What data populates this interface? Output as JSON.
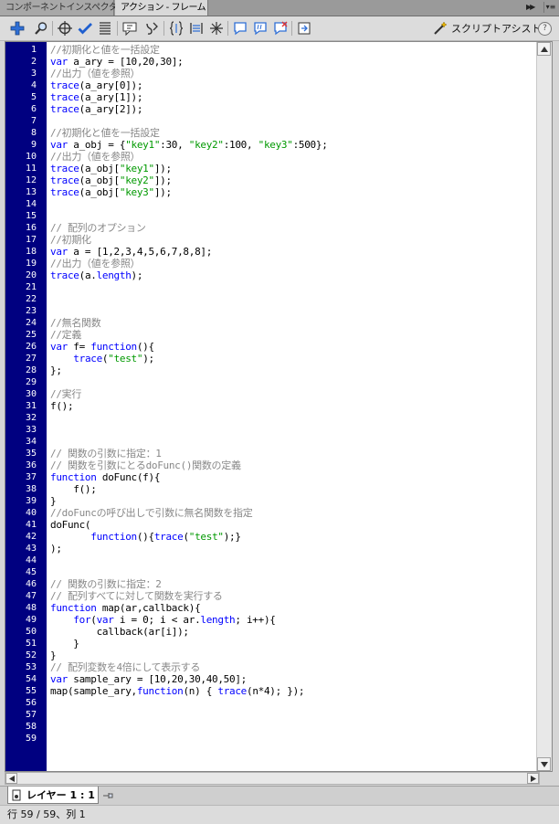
{
  "tabs": [
    {
      "label": "コンポーネントインスペクタ",
      "active": false
    },
    {
      "label": "アクション - フレーム",
      "active": true
    }
  ],
  "toolbar": {
    "icons": [
      "add-script-item-icon",
      "find-icon",
      "insert-target-path-icon",
      "check-syntax-icon",
      "auto-format-icon",
      "show-code-hint-icon",
      "debug-options-icon",
      "collapse-between-braces-icon",
      "collapse-selection-icon",
      "expand-all-icon",
      "apply-block-comment-icon",
      "apply-line-comment-icon",
      "remove-comment-icon",
      "show-hide-toolbox-icon"
    ],
    "script_assist_label": "スクリプトアシスト",
    "help_label": "?"
  },
  "colors": {
    "keyword": "#0000ff",
    "comment": "#888888",
    "string": "#009900",
    "gutter": "#000080"
  },
  "code": [
    [
      [
        "c",
        "//初期化と値を一括設定"
      ]
    ],
    [
      [
        "k",
        "var"
      ],
      [
        "t",
        " a_ary = [10,20,30];"
      ]
    ],
    [
      [
        "c",
        "//出力（値を参照）"
      ]
    ],
    [
      [
        "k",
        "trace"
      ],
      [
        "t",
        "(a_ary[0]);"
      ]
    ],
    [
      [
        "k",
        "trace"
      ],
      [
        "t",
        "(a_ary[1]);"
      ]
    ],
    [
      [
        "k",
        "trace"
      ],
      [
        "t",
        "(a_ary[2]);"
      ]
    ],
    [],
    [
      [
        "c",
        "//初期化と値を一括設定"
      ]
    ],
    [
      [
        "k",
        "var"
      ],
      [
        "t",
        " a_obj = {"
      ],
      [
        "s",
        "\"key1\""
      ],
      [
        "t",
        ":30, "
      ],
      [
        "s",
        "\"key2\""
      ],
      [
        "t",
        ":100, "
      ],
      [
        "s",
        "\"key3\""
      ],
      [
        "t",
        ":500};"
      ]
    ],
    [
      [
        "c",
        "//出力（値を参照）"
      ]
    ],
    [
      [
        "k",
        "trace"
      ],
      [
        "t",
        "(a_obj["
      ],
      [
        "s",
        "\"key1\""
      ],
      [
        "t",
        "]);"
      ]
    ],
    [
      [
        "k",
        "trace"
      ],
      [
        "t",
        "(a_obj["
      ],
      [
        "s",
        "\"key2\""
      ],
      [
        "t",
        "]);"
      ]
    ],
    [
      [
        "k",
        "trace"
      ],
      [
        "t",
        "(a_obj["
      ],
      [
        "s",
        "\"key3\""
      ],
      [
        "t",
        "]);"
      ]
    ],
    [],
    [],
    [
      [
        "c",
        "// 配列のオプション"
      ]
    ],
    [
      [
        "c",
        "//初期化"
      ]
    ],
    [
      [
        "k",
        "var"
      ],
      [
        "t",
        " a = [1,2,3,4,5,6,7,8,8];"
      ]
    ],
    [
      [
        "c",
        "//出力（値を参照）"
      ]
    ],
    [
      [
        "k",
        "trace"
      ],
      [
        "t",
        "(a."
      ],
      [
        "k",
        "length"
      ],
      [
        "t",
        ");"
      ]
    ],
    [],
    [],
    [],
    [
      [
        "c",
        "//無名関数"
      ]
    ],
    [
      [
        "c",
        "//定義"
      ]
    ],
    [
      [
        "k",
        "var"
      ],
      [
        "t",
        " f= "
      ],
      [
        "k",
        "function"
      ],
      [
        "t",
        "(){"
      ]
    ],
    [
      [
        "t",
        "    "
      ],
      [
        "k",
        "trace"
      ],
      [
        "t",
        "("
      ],
      [
        "s",
        "\"test\""
      ],
      [
        "t",
        ");"
      ]
    ],
    [
      [
        "t",
        "};"
      ]
    ],
    [],
    [
      [
        "c",
        "//実行"
      ]
    ],
    [
      [
        "t",
        "f();"
      ]
    ],
    [],
    [],
    [],
    [
      [
        "c",
        "// 関数の引数に指定：1"
      ]
    ],
    [
      [
        "c",
        "// 関数を引数にとるdoFunc()関数の定義"
      ]
    ],
    [
      [
        "k",
        "function"
      ],
      [
        "t",
        " doFunc(f){"
      ]
    ],
    [
      [
        "t",
        "    f();"
      ]
    ],
    [
      [
        "t",
        "}"
      ]
    ],
    [
      [
        "c",
        "//doFuncの呼び出しで引数に無名関数を指定"
      ]
    ],
    [
      [
        "t",
        "doFunc("
      ]
    ],
    [
      [
        "t",
        "       "
      ],
      [
        "k",
        "function"
      ],
      [
        "t",
        "(){"
      ],
      [
        "k",
        "trace"
      ],
      [
        "t",
        "("
      ],
      [
        "s",
        "\"test\""
      ],
      [
        "t",
        ");}"
      ]
    ],
    [
      [
        "t",
        ");"
      ]
    ],
    [],
    [],
    [
      [
        "c",
        "// 関数の引数に指定：2"
      ]
    ],
    [
      [
        "c",
        "// 配列すべてに対して関数を実行する"
      ]
    ],
    [
      [
        "k",
        "function"
      ],
      [
        "t",
        " map(ar,callback){"
      ]
    ],
    [
      [
        "t",
        "    "
      ],
      [
        "k",
        "for"
      ],
      [
        "t",
        "("
      ],
      [
        "k",
        "var"
      ],
      [
        "t",
        " i = 0; i < ar."
      ],
      [
        "k",
        "length"
      ],
      [
        "t",
        "; i++){"
      ]
    ],
    [
      [
        "t",
        "        callback(ar[i]);"
      ]
    ],
    [
      [
        "t",
        "    }"
      ]
    ],
    [
      [
        "t",
        "}"
      ]
    ],
    [
      [
        "c",
        "// 配列変数を4倍にして表示する"
      ]
    ],
    [
      [
        "k",
        "var"
      ],
      [
        "t",
        " sample_ary = [10,20,30,40,50];"
      ]
    ],
    [
      [
        "t",
        "map(sample_ary,"
      ],
      [
        "k",
        "function"
      ],
      [
        "t",
        "(n) { "
      ],
      [
        "k",
        "trace"
      ],
      [
        "t",
        "(n*4); });"
      ]
    ],
    [],
    [],
    [],
    []
  ],
  "layer": {
    "label": "レイヤー 1 : 1"
  },
  "status": {
    "text": "行 59 / 59、列 1"
  }
}
